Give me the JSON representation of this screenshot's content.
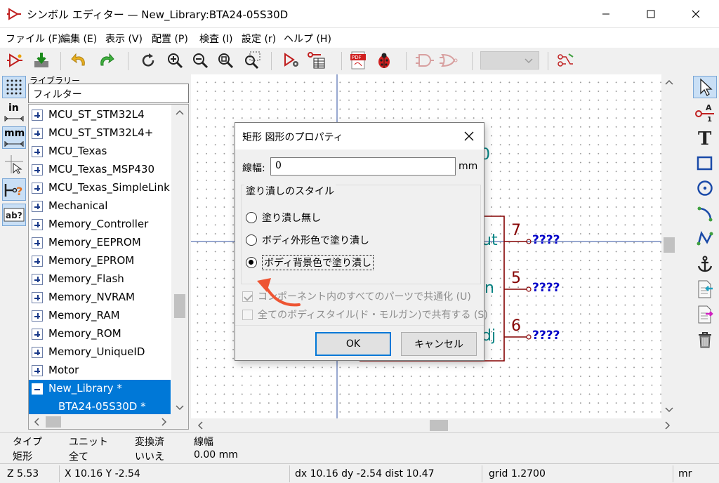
{
  "window": {
    "title": "シンボル エディター — New_Library:BTA24-05S30D"
  },
  "menu": [
    "ファイル (F)",
    "編集 (E)",
    "表示 (V)",
    "配置 (P)",
    "検査 (I)",
    "設定 (r)",
    "ヘルプ (H)"
  ],
  "library": {
    "panel_label": "ライブラリー",
    "filter_placeholder": "フィルター",
    "items": [
      {
        "label": "MCU_ST_STM32L4",
        "expanded": false
      },
      {
        "label": "MCU_ST_STM32L4+",
        "expanded": false
      },
      {
        "label": "MCU_Texas",
        "expanded": false
      },
      {
        "label": "MCU_Texas_MSP430",
        "expanded": false
      },
      {
        "label": "MCU_Texas_SimpleLink",
        "expanded": false
      },
      {
        "label": "Mechanical",
        "expanded": false
      },
      {
        "label": "Memory_Controller",
        "expanded": false
      },
      {
        "label": "Memory_EEPROM",
        "expanded": false
      },
      {
        "label": "Memory_EPROM",
        "expanded": false
      },
      {
        "label": "Memory_Flash",
        "expanded": false
      },
      {
        "label": "Memory_NVRAM",
        "expanded": false
      },
      {
        "label": "Memory_RAM",
        "expanded": false
      },
      {
        "label": "Memory_ROM",
        "expanded": false
      },
      {
        "label": "Memory_UniqueID",
        "expanded": false
      },
      {
        "label": "Motor",
        "expanded": false
      },
      {
        "label": "New_Library *",
        "expanded": true
      }
    ],
    "child_item": "BTA24-05S30D *"
  },
  "left_toolbar": {
    "units_in": "in",
    "units_mm": "mm"
  },
  "canvas": {
    "pins": [
      {
        "number": "7",
        "label": "????",
        "pin_text": "ut"
      },
      {
        "number": "5",
        "label": "????",
        "pin_text": "n"
      },
      {
        "number": "6",
        "label": "????",
        "pin_text": "dj"
      }
    ],
    "partial_text": "0"
  },
  "dialog": {
    "title": "矩形 図形のプロパティ",
    "line_width_label": "線幅:",
    "line_width_value": "0",
    "line_width_unit": "mm",
    "fill_group_label": "塗り潰しのスタイル",
    "fill_options": [
      {
        "label": "塗り潰し無し",
        "checked": false
      },
      {
        "label": "ボディ外形色で塗り潰し",
        "checked": false
      },
      {
        "label": "ボディ背景色で塗り潰し",
        "checked": true
      }
    ],
    "check_common_units": "コンポーネント内のすべてのパーツで共通化 (U)",
    "check_common_convert": "全てのボディスタイル(ド・モルガン)で共有する (S)",
    "ok_label": "OK",
    "cancel_label": "キャンセル"
  },
  "message_panel": {
    "type_header": "タイプ",
    "type_value": "矩形",
    "unit_header": "ユニット",
    "unit_value": "全て",
    "converted_header": "変換済",
    "converted_value": "いいえ",
    "line_width_header": "線幅",
    "line_width_value": "0.00 mm"
  },
  "status": {
    "zoom": "Z 5.53",
    "xy": "X 10.16  Y -2.54",
    "delta": "dx 10.16  dy -2.54  dist 10.47",
    "grid": "grid 1.2700",
    "units": "mr"
  },
  "colors": {
    "selection_blue": "#0078d7",
    "symbol_red": "#840000",
    "pin_text_teal": "#008484",
    "net_blue": "#0000c8",
    "annotation_orange": "#ee5533"
  }
}
